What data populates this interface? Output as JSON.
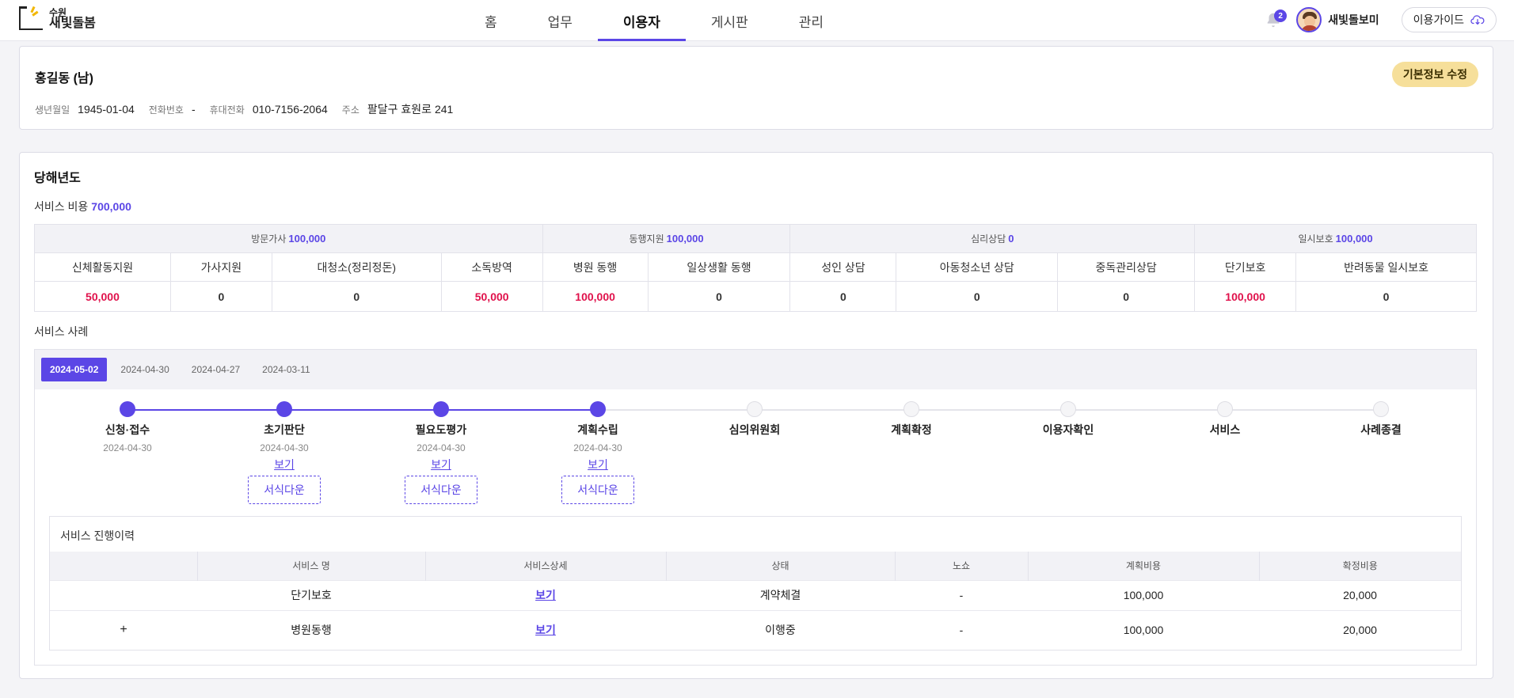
{
  "header": {
    "logo_small": "수원",
    "logo_big": "새빛돌봄",
    "nav": [
      "홈",
      "업무",
      "이용자",
      "게시판",
      "관리"
    ],
    "nav_active": 2,
    "notification_count": "2",
    "username": "새빛돌보미",
    "guide_label": "이용가이드"
  },
  "profile": {
    "name": "홍길동 (남)",
    "edit_label": "기본정보 수정",
    "birth_label": "생년월일",
    "birth": "1945-01-04",
    "phone_label": "전화번호",
    "phone": "-",
    "mobile_label": "휴대전화",
    "mobile": "010-7156-2064",
    "address_label": "주소",
    "address": "팔달구 효원로 241"
  },
  "main": {
    "title": "당해년도",
    "cost_label": "서비스 비용",
    "cost_value": "700,000",
    "groups": [
      {
        "label": "방문가사",
        "value": "100,000"
      },
      {
        "label": "동행지원",
        "value": "100,000"
      },
      {
        "label": "심리상담",
        "value": "0"
      },
      {
        "label": "일시보호",
        "value": "100,000"
      }
    ],
    "sub_headers": [
      "신체활동지원",
      "가사지원",
      "대청소(정리정돈)",
      "소독방역",
      "병원 동행",
      "일상생활 동행",
      "성인 상담",
      "아동청소년 상담",
      "중독관리상담",
      "단기보호",
      "반려동물 일시보호"
    ],
    "sub_values": [
      "50,000",
      "0",
      "0",
      "50,000",
      "100,000",
      "0",
      "0",
      "0",
      "0",
      "100,000",
      "0"
    ],
    "case_title": "서비스 사례",
    "date_tabs": [
      "2024-05-02",
      "2024-04-30",
      "2024-04-27",
      "2024-03-11"
    ],
    "steps": [
      {
        "label": "신청·접수",
        "date": "2024-04-30"
      },
      {
        "label": "초기판단",
        "date": "2024-04-30",
        "view": "보기",
        "download": "서식다운"
      },
      {
        "label": "필요도평가",
        "date": "2024-04-30",
        "view": "보기",
        "download": "서식다운"
      },
      {
        "label": "계획수립",
        "date": "2024-04-30",
        "view": "보기",
        "download": "서식다운"
      },
      {
        "label": "심의위원회"
      },
      {
        "label": "계획확정"
      },
      {
        "label": "이용자확인"
      },
      {
        "label": "서비스"
      },
      {
        "label": "사례종결"
      }
    ],
    "history": {
      "title": "서비스 진행이력",
      "columns": [
        "",
        "서비스 명",
        "서비스상세",
        "상태",
        "노쇼",
        "계획비용",
        "확정비용"
      ],
      "rows": [
        {
          "expand": "",
          "name": "단기보호",
          "detail": "보기",
          "status": "계약체결",
          "noshow": "-",
          "plan": "100,000",
          "confirmed": "20,000"
        },
        {
          "expand": "+",
          "name": "병원동행",
          "detail": "보기",
          "status": "이행중",
          "noshow": "-",
          "plan": "100,000",
          "confirmed": "20,000"
        }
      ]
    }
  },
  "colors": {
    "accent": "#5b46e6",
    "highlight": "#e0114b",
    "edit_button": "#f6df9a"
  }
}
